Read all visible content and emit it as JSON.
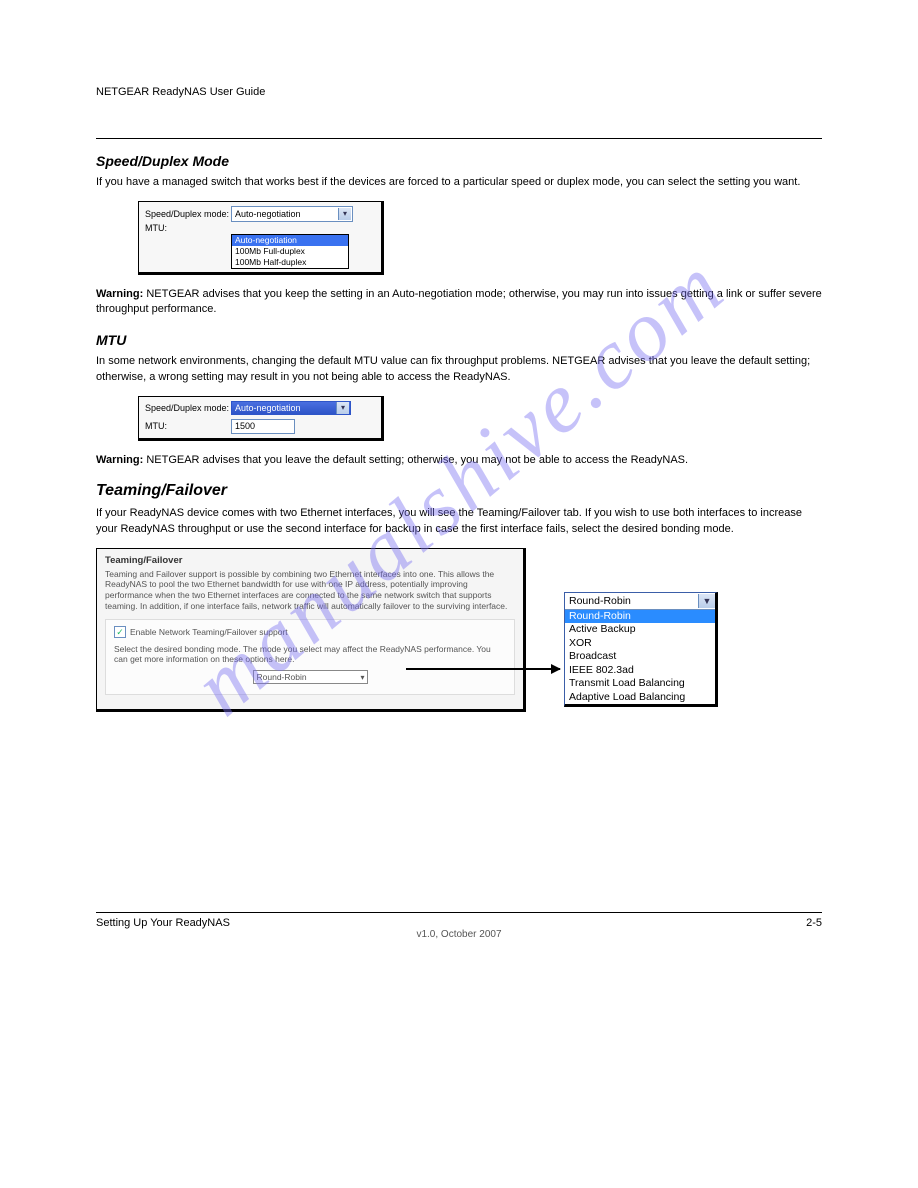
{
  "header": {
    "left": "NETGEAR ReadyNAS User Guide",
    "right": ""
  },
  "watermark": "manualshive.com",
  "section_speed_title": "Speed/Duplex Mode",
  "section_speed_text": "If you have a managed switch that works best if the devices are forced to a particular speed or duplex mode, you can select the setting you want.",
  "panel1": {
    "label_speed": "Speed/Duplex mode:",
    "label_mtu": "MTU:",
    "sel_value": "Auto-negotiation",
    "options": [
      "Auto-negotiation",
      "100Mb Full-duplex",
      "100Mb Half-duplex"
    ]
  },
  "warn_speed": "NETGEAR advises that you keep the setting in an Auto-negotiation mode; otherwise, you may run into issues getting a link or suffer severe throughput performance.",
  "section_mtu_title": "MTU",
  "section_mtu_text": "In some network environments, changing the default MTU value can fix throughput problems. NETGEAR advises that you leave the default setting; otherwise, a wrong setting may result in you not being able to access the ReadyNAS.",
  "panel2": {
    "label_speed": "Speed/Duplex mode:",
    "label_mtu": "MTU:",
    "sel_value": "Auto-negotiation",
    "mtu_value": "1500"
  },
  "warn_mtu": "NETGEAR advises that you leave the default setting; otherwise, you may not be able to access the ReadyNAS.",
  "teaming_title": "Teaming/Failover",
  "teaming_intro": "If your ReadyNAS device comes with two Ethernet interfaces, you will see the Teaming/Failover tab. If you wish to use both interfaces to increase your ReadyNAS throughput or use the second interface for backup in case the first interface fails, select the desired bonding mode.",
  "tf": {
    "heading": "Teaming/Failover",
    "desc": "Teaming and Failover support is possible by combining two Ethernet interfaces into one. This allows the ReadyNAS to pool the two Ethernet bandwidth for use with one IP address, potentially improving performance when the two Ethernet interfaces are connected to the same network switch that supports teaming. In addition, if one interface fails, network traffic will automatically failover to the surviving interface.",
    "check_label": "Enable Network Teaming/Failover support",
    "instr": "Select the desired bonding mode. The mode you select may affect the ReadyNAS performance. You can get more information on these options here.",
    "mode_value": "Round-Robin"
  },
  "bigsel": {
    "top": "Round-Robin",
    "options": [
      "Round-Robin",
      "Active Backup",
      "XOR",
      "Broadcast",
      "IEEE 802.3ad",
      "Transmit Load Balancing",
      "Adaptive Load Balancing"
    ]
  },
  "footer": {
    "chapter": "Setting Up Your ReadyNAS",
    "pagenum": "2-5",
    "version": "v1.0, October 2007"
  },
  "warning_label": "Warning:"
}
